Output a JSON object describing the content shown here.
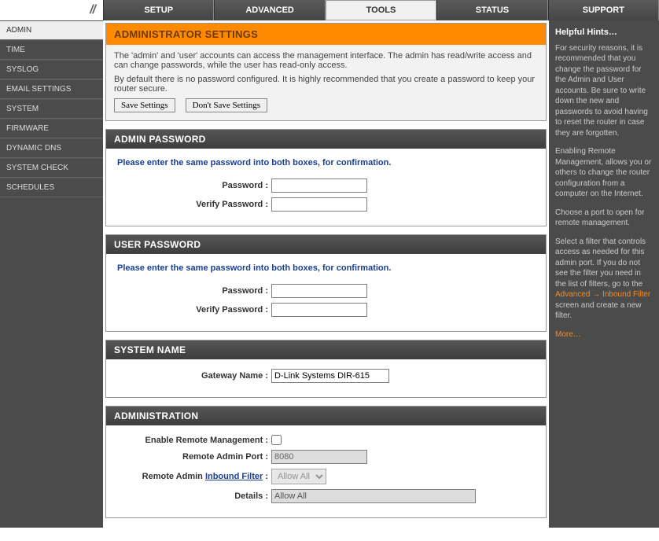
{
  "logo_text": "//",
  "tabs": [
    "SETUP",
    "ADVANCED",
    "TOOLS",
    "STATUS",
    "SUPPORT"
  ],
  "sidebar": [
    "ADMIN",
    "TIME",
    "SYSLOG",
    "EMAIL SETTINGS",
    "SYSTEM",
    "FIRMWARE",
    "DYNAMIC DNS",
    "SYSTEM CHECK",
    "SCHEDULES"
  ],
  "page": {
    "title": "ADMINISTRATOR SETTINGS",
    "intro1": "The 'admin' and 'user' accounts can access the management interface. The admin has read/write access and can change passwords, while the user has read-only access.",
    "intro2": "By default there is no password configured. It is highly recommended that you create a password to keep your router secure.",
    "save": "Save Settings",
    "dontsave": "Don't Save Settings"
  },
  "adminpw": {
    "head": "ADMIN PASSWORD",
    "instruct": "Please enter the same password into both boxes, for confirmation.",
    "pw_label": "Password :",
    "vpw_label": "Verify Password :"
  },
  "userpw": {
    "head": "USER PASSWORD",
    "instruct": "Please enter the same password into both boxes, for confirmation.",
    "pw_label": "Password :",
    "vpw_label": "Verify Password :"
  },
  "sysname": {
    "head": "SYSTEM NAME",
    "label": "Gateway Name :",
    "value": "D-Link Systems DIR-615"
  },
  "admin_sec": {
    "head": "ADMINISTRATION",
    "enable_label": "Enable Remote Management :",
    "port_label": "Remote Admin Port :",
    "port_value": "8080",
    "filter_label_a": "Remote Admin ",
    "filter_label_b": "Inbound Filter",
    "filter_label_c": " :",
    "filter_value": "Allow All",
    "details_label": "Details :",
    "details_value": "Allow All"
  },
  "hints": {
    "title": "Helpful Hints…",
    "p1": "For security reasons, it is recommended that you change the password for the Admin and User accounts. Be sure to write down the new and passwords to avoid having to reset the router in case they are forgotten.",
    "p2": "Enabling Remote Management, allows you or others to change the router configuration from a computer on the Internet.",
    "p3": "Choose a port to open for remote management.",
    "p4a": "Select a filter that controls access as needed for this admin port. If you do not see the filter you need in the list of filters, go to the ",
    "p4_link1": "Advanced",
    "p4_arrow": " → ",
    "p4_link2": "Inbound Filter",
    "p4b": " screen and create a new filter.",
    "more": "More…"
  }
}
